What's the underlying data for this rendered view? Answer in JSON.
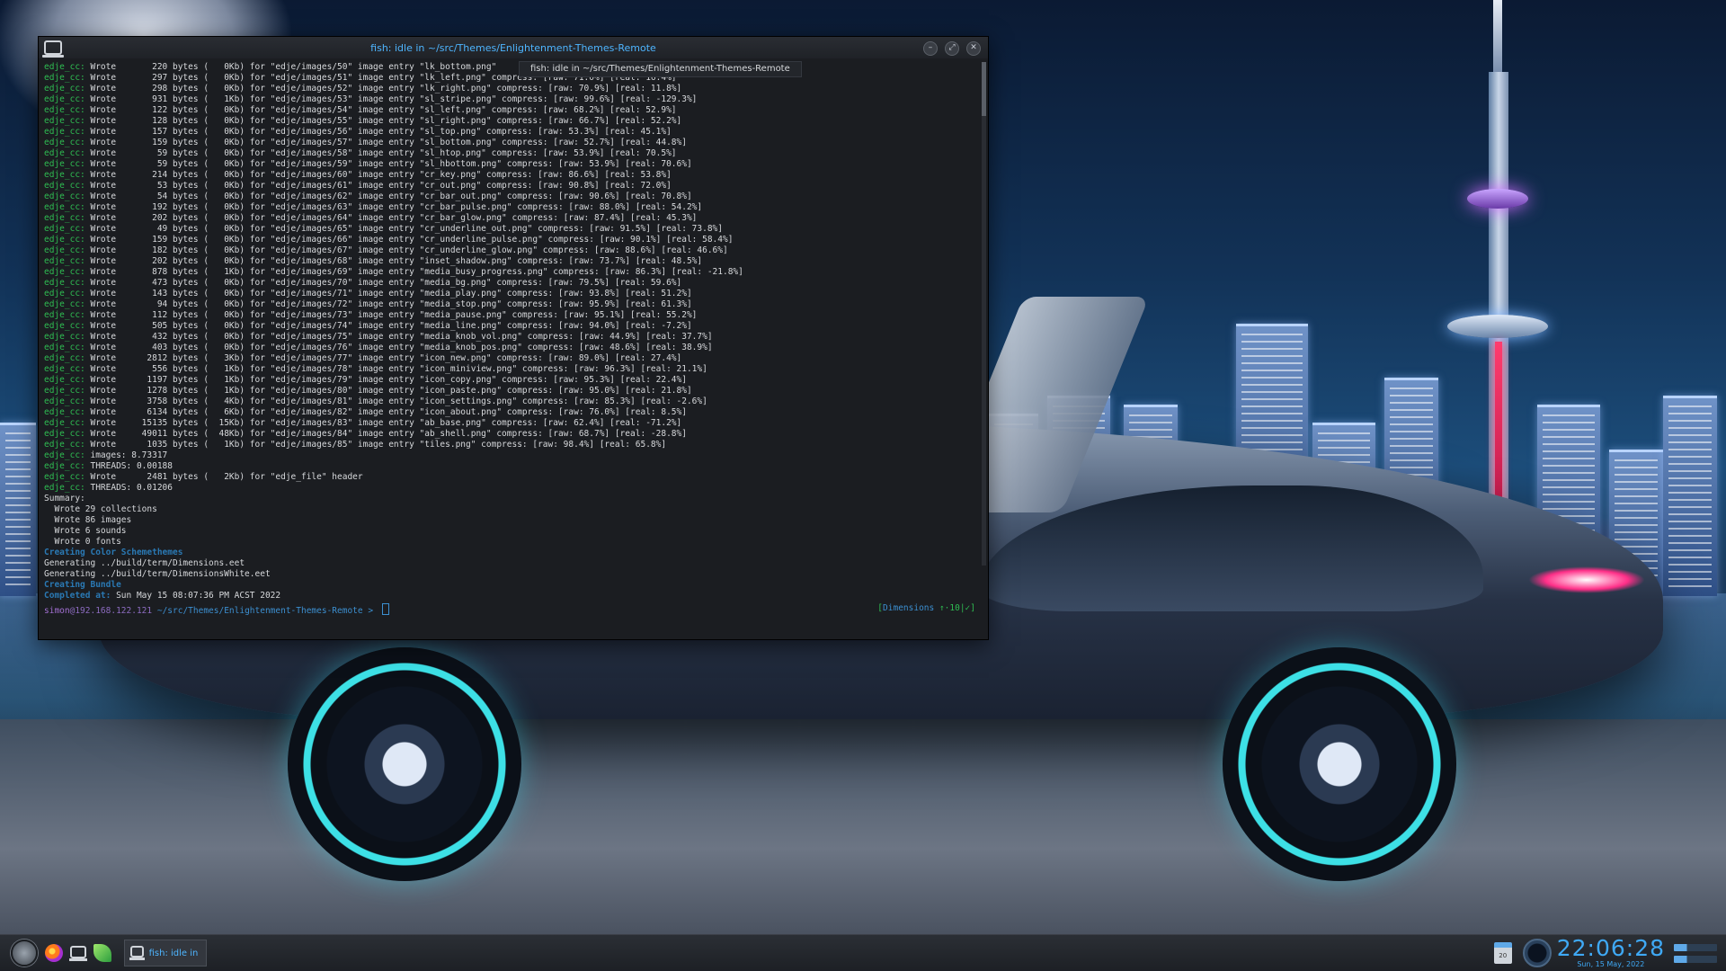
{
  "window": {
    "title": "fish: idle in ~/src/Themes/Enlightenment-Themes-Remote",
    "tooltip": "fish: idle in ~/src/Themes/Enlightenment-Themes-Remote",
    "buttons": [
      "minimize",
      "maximize",
      "close"
    ]
  },
  "terminal": {
    "lines": [
      {
        "p": "edje_cc: ",
        "t": "Wrote       220 bytes (   0Kb) for \"edje/images/50\" image entry \"lk_bottom.png\""
      },
      {
        "p": "edje_cc: ",
        "t": "Wrote       297 bytes (   0Kb) for \"edje/images/51\" image entry \"lk_left.png\" compress: [raw: 71.0%] [real: 16.4%]"
      },
      {
        "p": "edje_cc: ",
        "t": "Wrote       298 bytes (   0Kb) for \"edje/images/52\" image entry \"lk_right.png\" compress: [raw: 70.9%] [real: 11.8%]"
      },
      {
        "p": "edje_cc: ",
        "t": "Wrote       931 bytes (   1Kb) for \"edje/images/53\" image entry \"sl_stripe.png\" compress: [raw: 99.6%] [real: -129.3%]"
      },
      {
        "p": "edje_cc: ",
        "t": "Wrote       122 bytes (   0Kb) for \"edje/images/54\" image entry \"sl_left.png\" compress: [raw: 68.2%] [real: 52.9%]"
      },
      {
        "p": "edje_cc: ",
        "t": "Wrote       128 bytes (   0Kb) for \"edje/images/55\" image entry \"sl_right.png\" compress: [raw: 66.7%] [real: 52.2%]"
      },
      {
        "p": "edje_cc: ",
        "t": "Wrote       157 bytes (   0Kb) for \"edje/images/56\" image entry \"sl_top.png\" compress: [raw: 53.3%] [real: 45.1%]"
      },
      {
        "p": "edje_cc: ",
        "t": "Wrote       159 bytes (   0Kb) for \"edje/images/57\" image entry \"sl_bottom.png\" compress: [raw: 52.7%] [real: 44.8%]"
      },
      {
        "p": "edje_cc: ",
        "t": "Wrote        59 bytes (   0Kb) for \"edje/images/58\" image entry \"sl_htop.png\" compress: [raw: 53.9%] [real: 70.5%]"
      },
      {
        "p": "edje_cc: ",
        "t": "Wrote        59 bytes (   0Kb) for \"edje/images/59\" image entry \"sl_hbottom.png\" compress: [raw: 53.9%] [real: 70.6%]"
      },
      {
        "p": "edje_cc: ",
        "t": "Wrote       214 bytes (   0Kb) for \"edje/images/60\" image entry \"cr_key.png\" compress: [raw: 86.6%] [real: 53.8%]"
      },
      {
        "p": "edje_cc: ",
        "t": "Wrote        53 bytes (   0Kb) for \"edje/images/61\" image entry \"cr_out.png\" compress: [raw: 90.8%] [real: 72.0%]"
      },
      {
        "p": "edje_cc: ",
        "t": "Wrote        54 bytes (   0Kb) for \"edje/images/62\" image entry \"cr_bar_out.png\" compress: [raw: 90.6%] [real: 70.8%]"
      },
      {
        "p": "edje_cc: ",
        "t": "Wrote       192 bytes (   0Kb) for \"edje/images/63\" image entry \"cr_bar_pulse.png\" compress: [raw: 88.0%] [real: 54.2%]"
      },
      {
        "p": "edje_cc: ",
        "t": "Wrote       202 bytes (   0Kb) for \"edje/images/64\" image entry \"cr_bar_glow.png\" compress: [raw: 87.4%] [real: 45.3%]"
      },
      {
        "p": "edje_cc: ",
        "t": "Wrote        49 bytes (   0Kb) for \"edje/images/65\" image entry \"cr_underline_out.png\" compress: [raw: 91.5%] [real: 73.8%]"
      },
      {
        "p": "edje_cc: ",
        "t": "Wrote       159 bytes (   0Kb) for \"edje/images/66\" image entry \"cr_underline_pulse.png\" compress: [raw: 90.1%] [real: 58.4%]"
      },
      {
        "p": "edje_cc: ",
        "t": "Wrote       182 bytes (   0Kb) for \"edje/images/67\" image entry \"cr_underline_glow.png\" compress: [raw: 88.6%] [real: 46.6%]"
      },
      {
        "p": "edje_cc: ",
        "t": "Wrote       202 bytes (   0Kb) for \"edje/images/68\" image entry \"inset_shadow.png\" compress: [raw: 73.7%] [real: 48.5%]"
      },
      {
        "p": "edje_cc: ",
        "t": "Wrote       878 bytes (   1Kb) for \"edje/images/69\" image entry \"media_busy_progress.png\" compress: [raw: 86.3%] [real: -21.8%]"
      },
      {
        "p": "edje_cc: ",
        "t": "Wrote       473 bytes (   0Kb) for \"edje/images/70\" image entry \"media_bg.png\" compress: [raw: 79.5%] [real: 59.6%]"
      },
      {
        "p": "edje_cc: ",
        "t": "Wrote       143 bytes (   0Kb) for \"edje/images/71\" image entry \"media_play.png\" compress: [raw: 93.8%] [real: 51.2%]"
      },
      {
        "p": "edje_cc: ",
        "t": "Wrote        94 bytes (   0Kb) for \"edje/images/72\" image entry \"media_stop.png\" compress: [raw: 95.9%] [real: 61.3%]"
      },
      {
        "p": "edje_cc: ",
        "t": "Wrote       112 bytes (   0Kb) for \"edje/images/73\" image entry \"media_pause.png\" compress: [raw: 95.1%] [real: 55.2%]"
      },
      {
        "p": "edje_cc: ",
        "t": "Wrote       505 bytes (   0Kb) for \"edje/images/74\" image entry \"media_line.png\" compress: [raw: 94.0%] [real: -7.2%]"
      },
      {
        "p": "edje_cc: ",
        "t": "Wrote       432 bytes (   0Kb) for \"edje/images/75\" image entry \"media_knob_vol.png\" compress: [raw: 44.9%] [real: 37.7%]"
      },
      {
        "p": "edje_cc: ",
        "t": "Wrote       403 bytes (   0Kb) for \"edje/images/76\" image entry \"media_knob_pos.png\" compress: [raw: 48.6%] [real: 38.9%]"
      },
      {
        "p": "edje_cc: ",
        "t": "Wrote      2812 bytes (   3Kb) for \"edje/images/77\" image entry \"icon_new.png\" compress: [raw: 89.0%] [real: 27.4%]"
      },
      {
        "p": "edje_cc: ",
        "t": "Wrote       556 bytes (   1Kb) for \"edje/images/78\" image entry \"icon_miniview.png\" compress: [raw: 96.3%] [real: 21.1%]"
      },
      {
        "p": "edje_cc: ",
        "t": "Wrote      1197 bytes (   1Kb) for \"edje/images/79\" image entry \"icon_copy.png\" compress: [raw: 95.3%] [real: 22.4%]"
      },
      {
        "p": "edje_cc: ",
        "t": "Wrote      1278 bytes (   1Kb) for \"edje/images/80\" image entry \"icon_paste.png\" compress: [raw: 95.0%] [real: 21.8%]"
      },
      {
        "p": "edje_cc: ",
        "t": "Wrote      3758 bytes (   4Kb) for \"edje/images/81\" image entry \"icon_settings.png\" compress: [raw: 85.3%] [real: -2.6%]"
      },
      {
        "p": "edje_cc: ",
        "t": "Wrote      6134 bytes (   6Kb) for \"edje/images/82\" image entry \"icon_about.png\" compress: [raw: 76.0%] [real: 8.5%]"
      },
      {
        "p": "edje_cc: ",
        "t": "Wrote     15135 bytes (  15Kb) for \"edje/images/83\" image entry \"ab_base.png\" compress: [raw: 62.4%] [real: -71.2%]"
      },
      {
        "p": "edje_cc: ",
        "t": "Wrote     49011 bytes (  48Kb) for \"edje/images/84\" image entry \"ab_shell.png\" compress: [raw: 68.7%] [real: -28.8%]"
      },
      {
        "p": "edje_cc: ",
        "t": "Wrote      1035 bytes (   1Kb) for \"edje/images/85\" image entry \"tiles.png\" compress: [raw: 98.4%] [real: 65.8%]"
      },
      {
        "p": "edje_cc: ",
        "t": "images: 8.73317"
      },
      {
        "p": "edje_cc: ",
        "t": "THREADS: 0.00188"
      },
      {
        "p": "edje_cc: ",
        "t": "Wrote      2481 bytes (   2Kb) for \"edje_file\" header"
      },
      {
        "p": "edje_cc: ",
        "t": "THREADS: 0.01206"
      },
      {
        "p": "",
        "t": "Summary:"
      },
      {
        "p": "",
        "t": "  Wrote 29 collections"
      },
      {
        "p": "",
        "t": "  Wrote 86 images"
      },
      {
        "p": "",
        "t": "  Wrote 6 sounds"
      },
      {
        "p": "",
        "t": "  Wrote 0 fonts"
      },
      {
        "p": "",
        "t": "",
        "h": "Creating Color Schemethemes"
      },
      {
        "p": "",
        "t": "Generating ../build/term/Dimensions.eet"
      },
      {
        "p": "",
        "t": "Generating ../build/term/DimensionsWhite.eet"
      },
      {
        "p": "",
        "t": "",
        "h": "Creating Bundle"
      },
      {
        "p": "",
        "t": " Sun May 15 08:07:36 PM ACST 2022",
        "h": "Completed at:"
      }
    ],
    "prompt": {
      "user": "simon",
      "host": "@192.168.122.121",
      "path": " ~/src/Themes/Enlightenment-Themes-Remote",
      "arrow": " >"
    },
    "right_prompt": {
      "branch": "Dimensions",
      "status": " ↑·10|✓]"
    }
  },
  "taskbar": {
    "launchers": [
      "start-menu",
      "firefox",
      "terminology",
      "leaf"
    ],
    "task_label": "fish: idle in ~...",
    "calendar_day": "20",
    "clock_time": "22:06:28",
    "clock_date": "Sun, 15 May, 2022"
  }
}
